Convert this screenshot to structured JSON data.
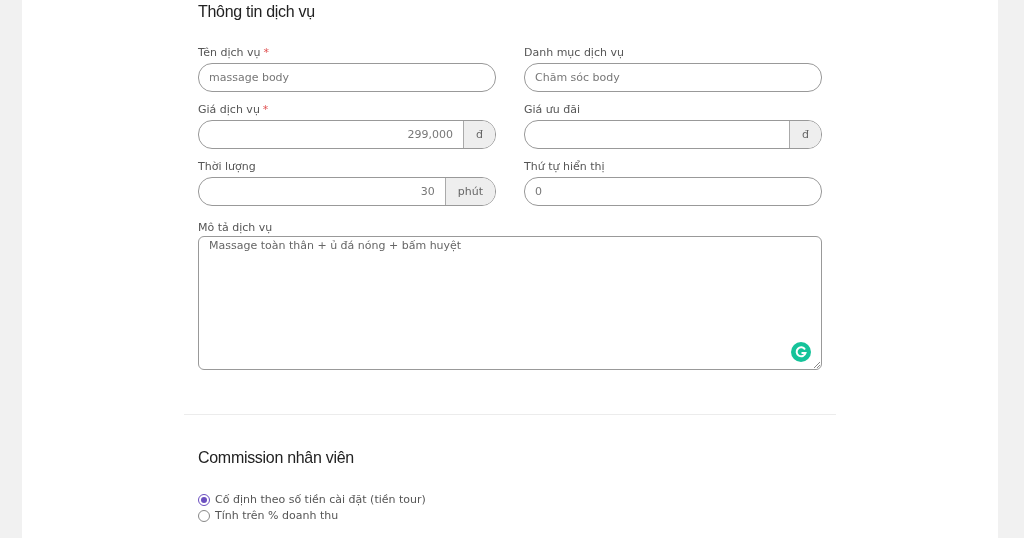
{
  "sections": [
    {
      "title": "Thông tin dịch vụ"
    },
    {
      "title": "Commission nhân viên"
    }
  ],
  "fields": [
    {
      "label": "Tên dịch vụ",
      "required_mark": "*",
      "kind": "text",
      "value": "massage body"
    },
    {
      "label": "Danh mục dịch vụ",
      "kind": "text",
      "value": "Chăm sóc body"
    },
    {
      "label": "Giá dịch vụ",
      "required_mark": "*",
      "kind": "suffix",
      "value": "299,000",
      "suffix": "đ"
    },
    {
      "label": "Giá ưu đãi",
      "kind": "suffix",
      "suffix": "đ"
    },
    {
      "label": "Thời lượng",
      "kind": "suffix",
      "value": "30",
      "suffix": "phút"
    },
    {
      "label": "Thứ tự hiển thị",
      "kind": "text",
      "value": "0"
    }
  ],
  "description": {
    "label": "Mô tả dịch vụ",
    "value": "Massage toàn thân + ủ đá nóng + bấm huyệt"
  },
  "commission_options": [
    {
      "label": "Cố định theo số tiền cài đặt (tiền tour)",
      "selected": true
    },
    {
      "label": "Tính trên % doanh thu",
      "selected": false
    }
  ]
}
